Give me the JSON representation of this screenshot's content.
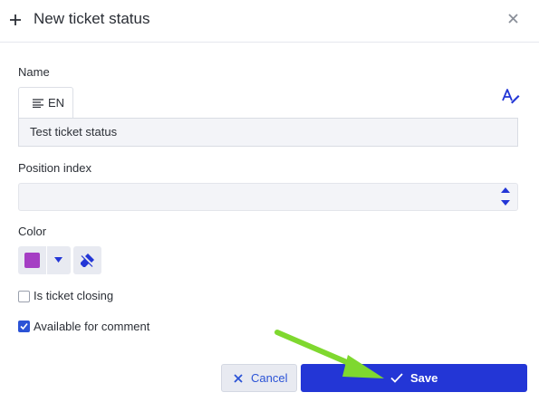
{
  "dialog": {
    "title": "New ticket status",
    "icons": {
      "header": "plus-icon",
      "close": "close-icon"
    }
  },
  "name_field": {
    "label": "Name",
    "language_tab": "EN",
    "value": "Test ticket status",
    "icons": {
      "tab": "lines-icon",
      "translate": "translate-icon"
    }
  },
  "position_field": {
    "label": "Position index",
    "value": ""
  },
  "color_field": {
    "label": "Color",
    "selected_color": "#a53ec4"
  },
  "checkboxes": [
    {
      "label": "Is ticket closing",
      "checked": false
    },
    {
      "label": "Available for comment",
      "checked": true
    }
  ],
  "actions": {
    "cancel_label": "Cancel",
    "save_label": "Save"
  },
  "colors": {
    "accent": "#2336d6",
    "link": "#2b53d6",
    "annotation_arrow": "#7fd82f"
  }
}
